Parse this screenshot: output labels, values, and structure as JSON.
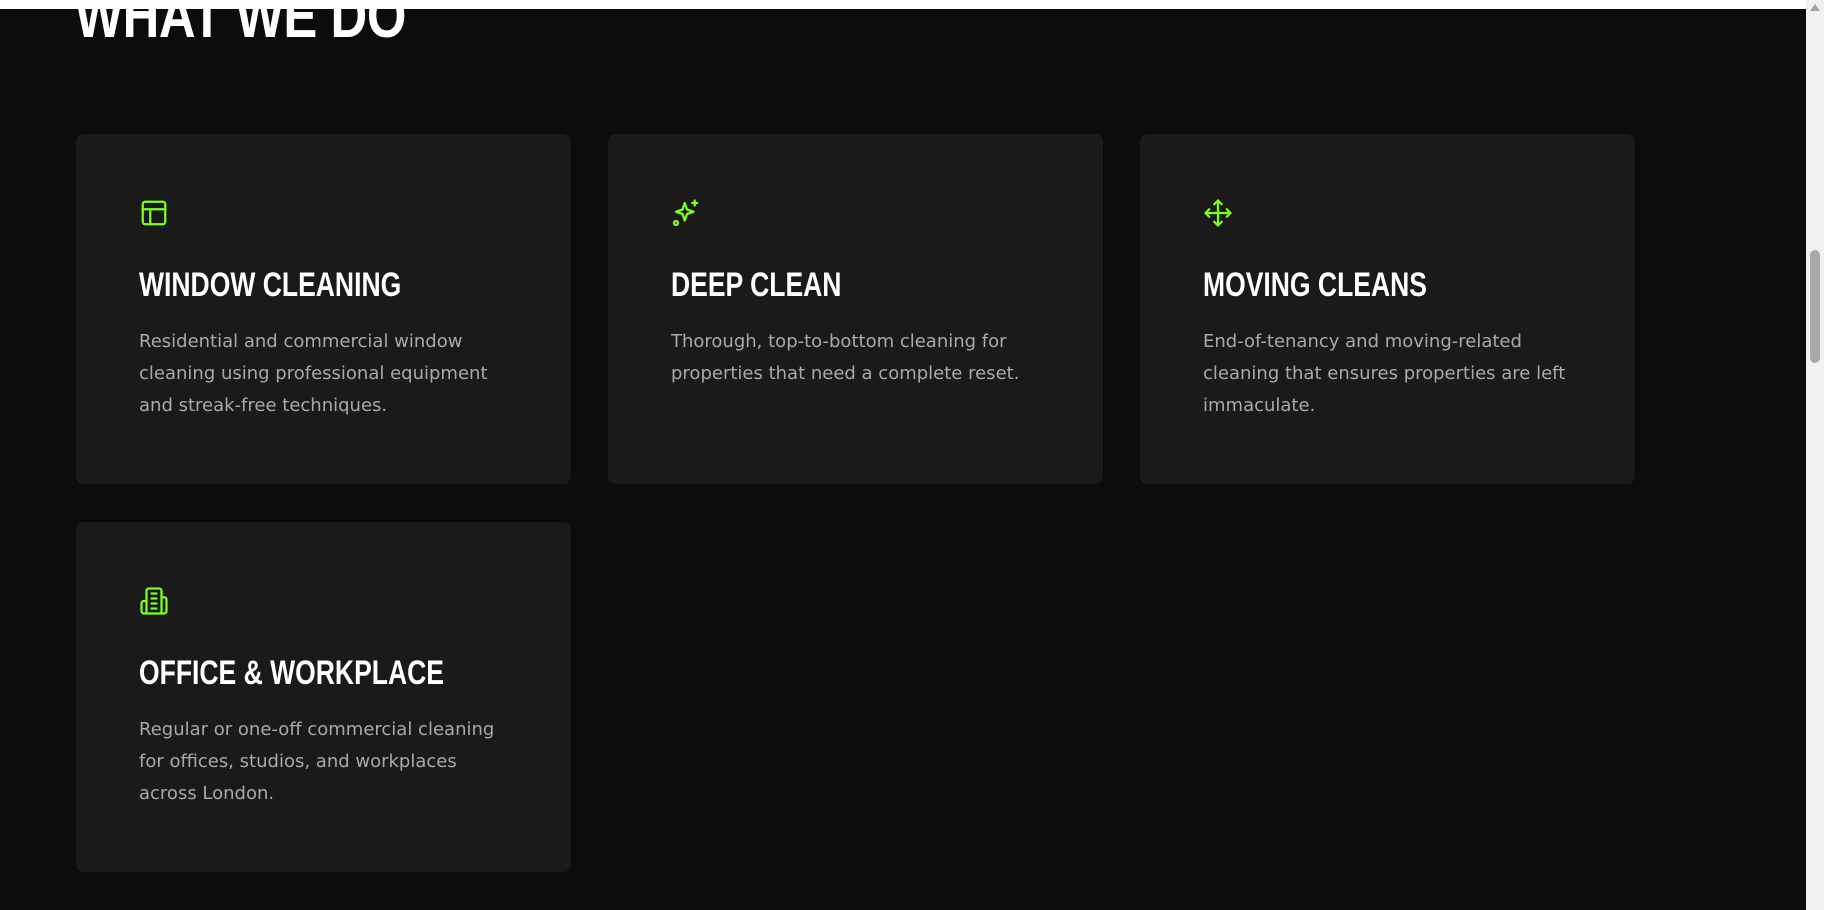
{
  "section": {
    "title": "WHAT WE DO"
  },
  "colors": {
    "accent": "#7cff1f",
    "background": "#0c0c0c",
    "card": "#1a1a1a",
    "title": "#ffffff",
    "body_text": "#a9a9a9"
  },
  "cards": [
    {
      "icon": "layout-icon",
      "title": "WINDOW CLEANING",
      "description": "Residential and commercial window cleaning using professional equipment and streak-free techniques."
    },
    {
      "icon": "sparkles-icon",
      "title": "DEEP CLEAN",
      "description": "Thorough, top-to-bottom cleaning for properties that need a complete reset."
    },
    {
      "icon": "move-arrows-icon",
      "title": "MOVING CLEANS",
      "description": "End-of-tenancy and moving-related cleaning that ensures properties are left immaculate."
    },
    {
      "icon": "building-icon",
      "title": "OFFICE & WORKPLACE",
      "description": "Regular or one-off commercial cleaning for offices, studios, and workplaces across London."
    }
  ]
}
